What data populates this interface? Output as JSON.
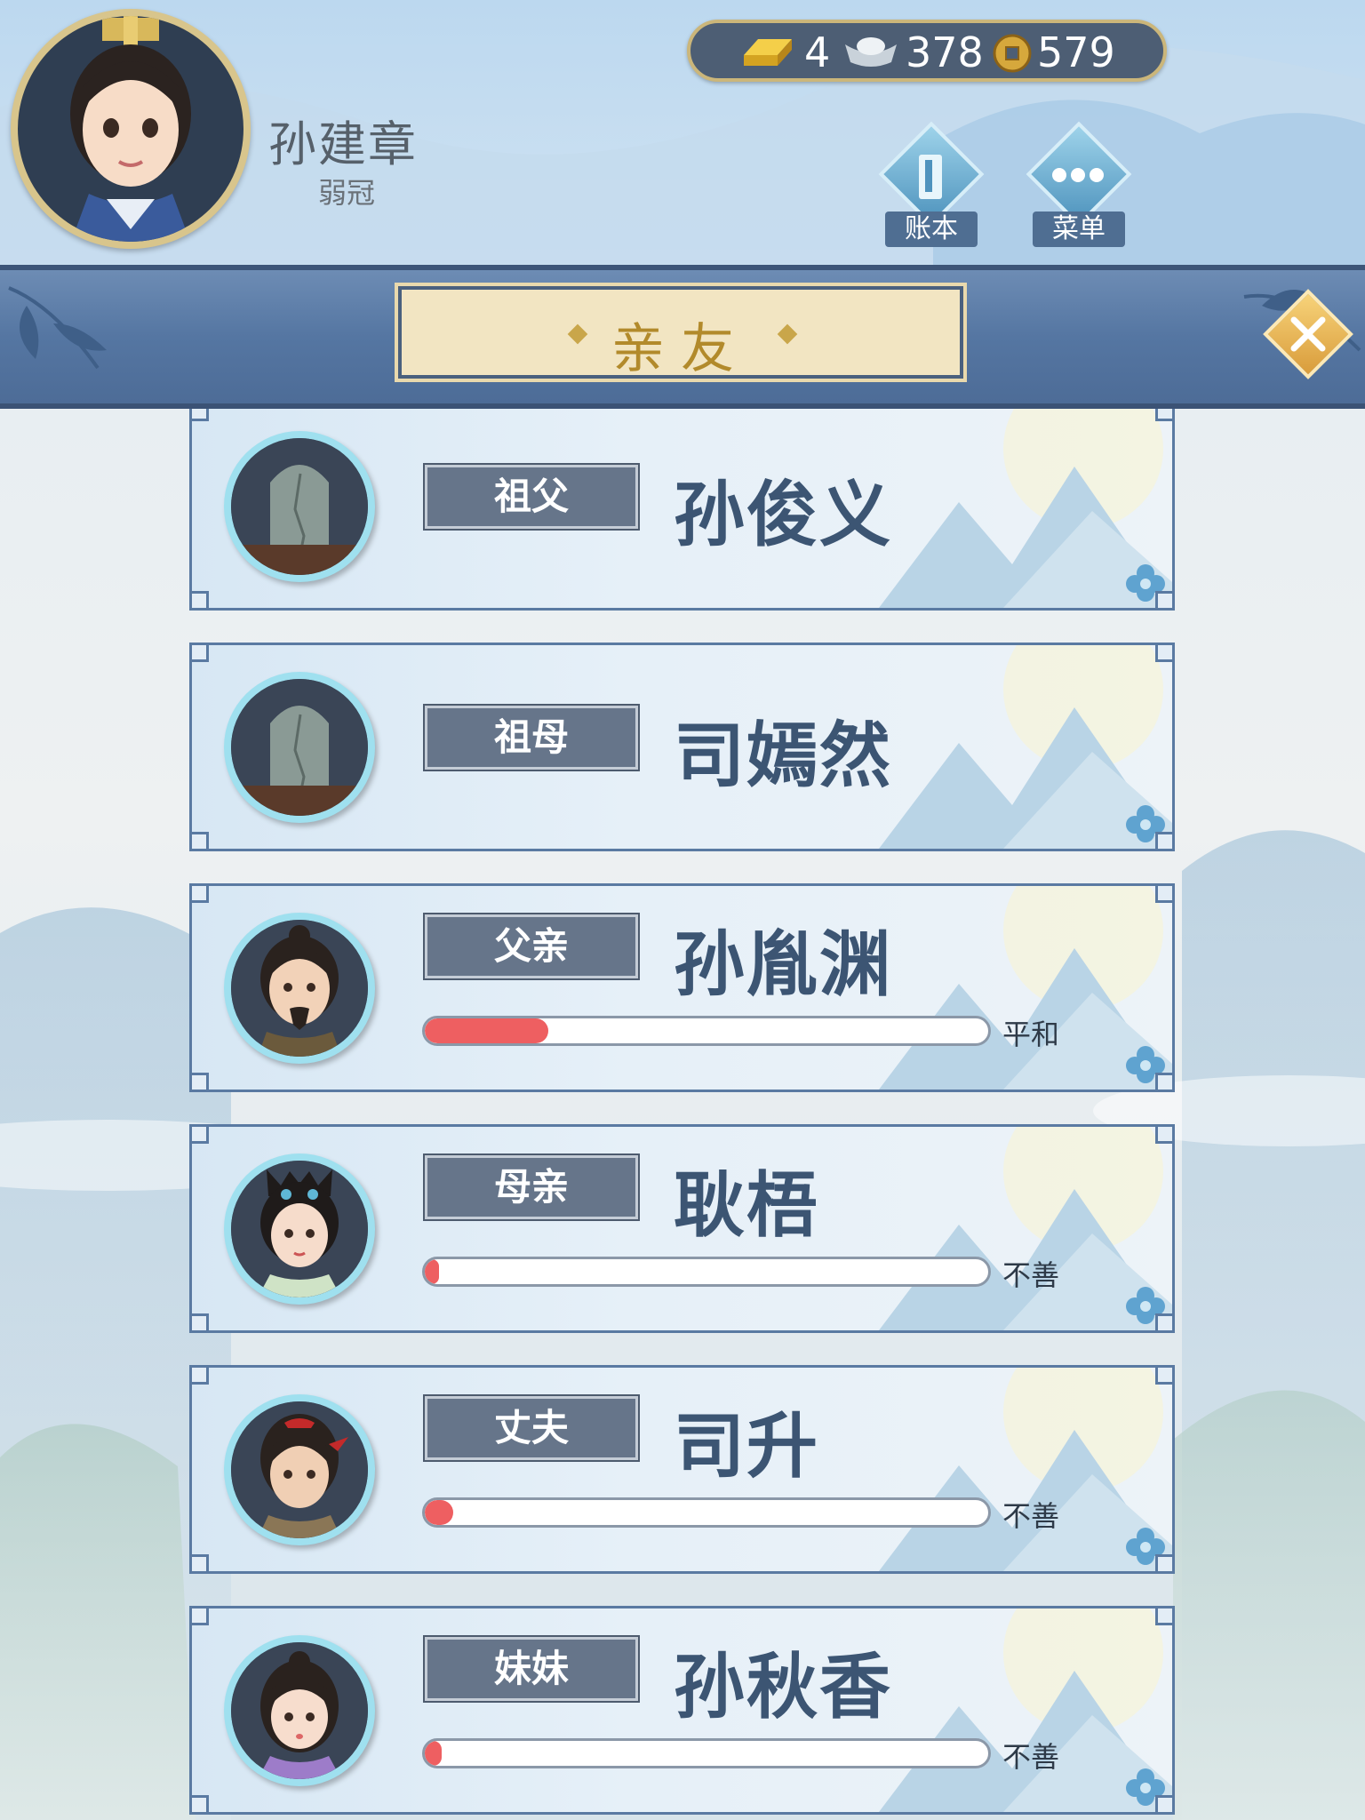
{
  "player": {
    "name": "孙建章",
    "age_title": "弱冠"
  },
  "currency": {
    "gold": "4",
    "silver": "378",
    "coins": "579",
    "gold_icon": "gold-bar-icon",
    "silver_icon": "silver-ingot-icon",
    "coin_icon": "copper-coin-icon"
  },
  "header_buttons": {
    "ledger_label": "账本",
    "menu_label": "菜单"
  },
  "panel": {
    "title": "亲友",
    "close_icon": "close-icon"
  },
  "relatives": [
    {
      "relation": "祖父",
      "name": "孙俊义",
      "deceased": true,
      "portrait": "tombstone"
    },
    {
      "relation": "祖母",
      "name": "司嫣然",
      "deceased": true,
      "portrait": "tombstone"
    },
    {
      "relation": "父亲",
      "name": "孙胤渊",
      "deceased": false,
      "portrait": "man-beard",
      "affinity": 0.22,
      "status": "平和"
    },
    {
      "relation": "母亲",
      "name": "耿梧",
      "deceased": false,
      "portrait": "woman-ornate",
      "affinity": 0.02,
      "status": "不善"
    },
    {
      "relation": "丈夫",
      "name": "司升",
      "deceased": false,
      "portrait": "young-man",
      "affinity": 0.05,
      "status": "不善"
    },
    {
      "relation": "妹妹",
      "name": "孙秋香",
      "deceased": false,
      "portrait": "girl",
      "affinity": 0.03,
      "status": "不善"
    }
  ],
  "colors": {
    "accent_gold": "#b28a2b",
    "bar_fill": "#ee5f61",
    "title_bar": "#5576a2"
  }
}
